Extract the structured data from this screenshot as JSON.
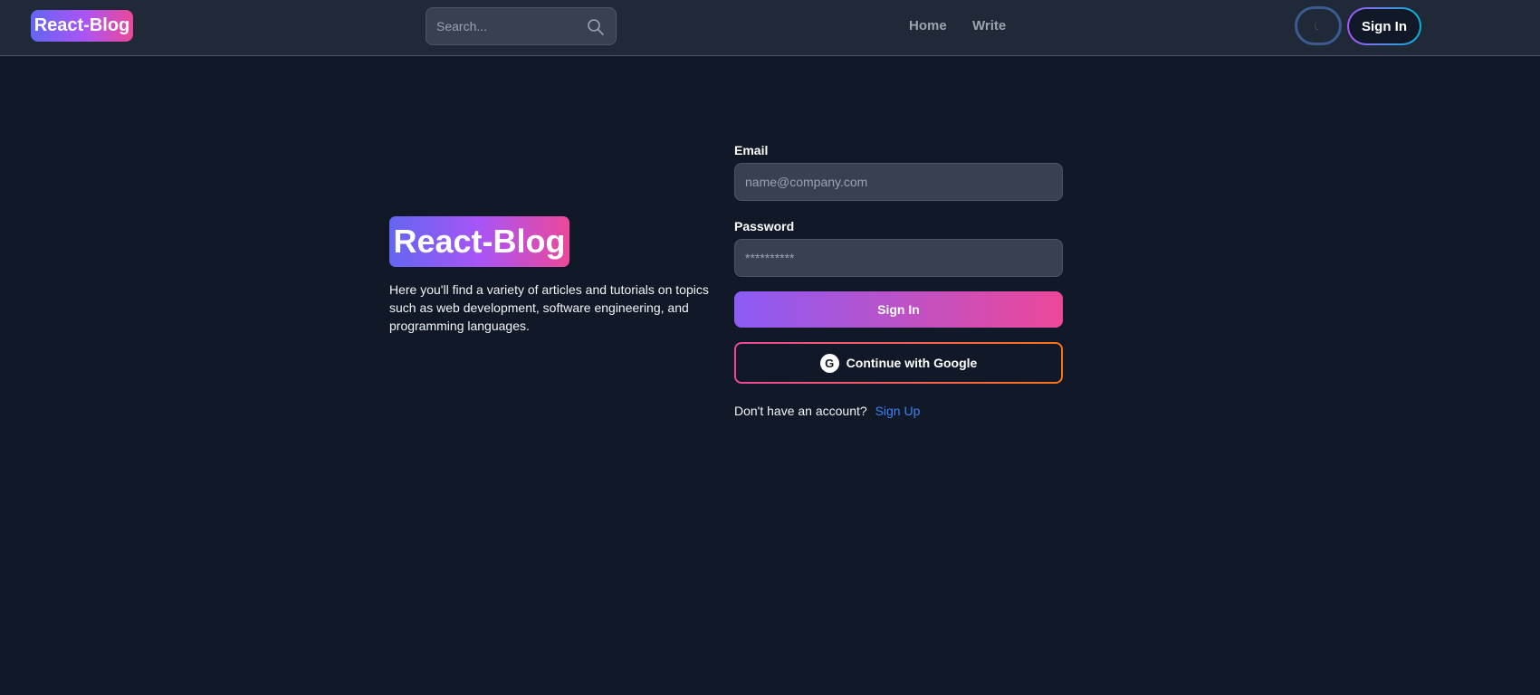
{
  "navbar": {
    "logo": "React-Blog",
    "search_placeholder": "Search...",
    "links": [
      "Home",
      "Write"
    ],
    "theme_icon": "moon-icon",
    "signin_label": "Sign In"
  },
  "hero": {
    "logo": "React-Blog",
    "tagline": "Here you'll find a variety of articles and tutorials on topics such as web development, software engineering, and programming languages."
  },
  "form": {
    "email_label": "Email",
    "email_placeholder": "name@company.com",
    "email_value": "",
    "password_label": "Password",
    "password_placeholder": "**********",
    "password_value": "",
    "signin_button": "Sign In",
    "google_icon": "G",
    "google_button": "Continue with Google",
    "signup_prompt": "Don't have an account?",
    "signup_link": "Sign Up"
  },
  "colors": {
    "background": "#111827",
    "navbar": "#1f2937",
    "field": "#374151",
    "link": "#3b82f6",
    "gradient_start": "#8b5cf6",
    "gradient_end": "#ec4899"
  }
}
